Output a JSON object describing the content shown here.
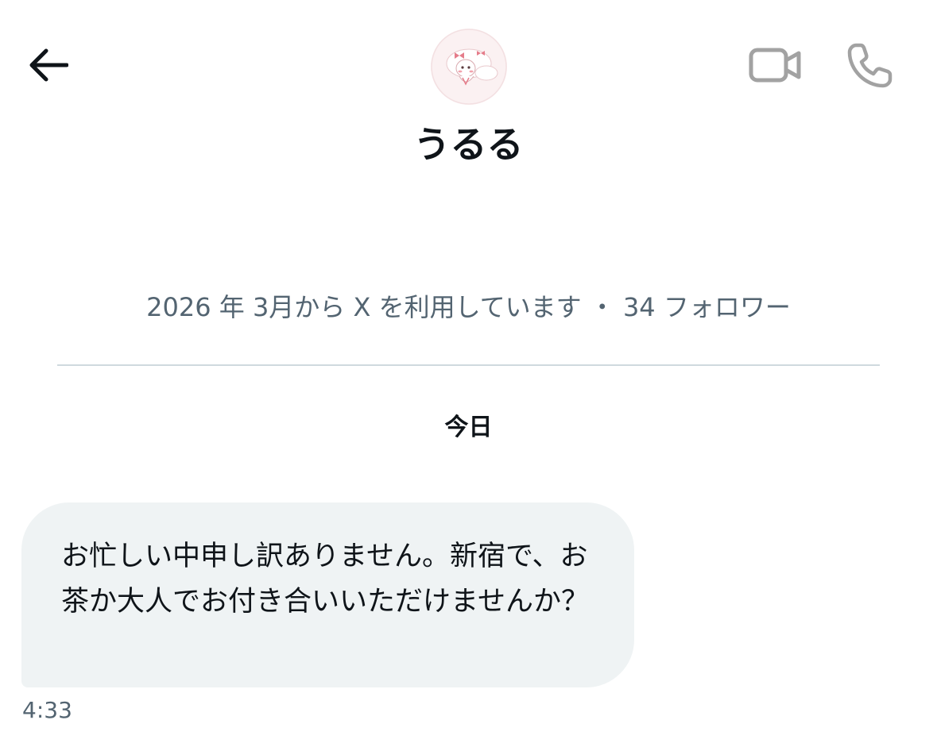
{
  "header": {
    "back_icon": "arrow-left-icon",
    "video_icon": "video-camera-icon",
    "call_icon": "phone-icon",
    "display_name": "うるる",
    "avatar_icon": "illustrated-character-avatar"
  },
  "profile": {
    "account_info": "2026 年 3月から X を利用しています ・ 34 フォロワー"
  },
  "conversation": {
    "date_label": "今日",
    "messages": [
      {
        "text": "お忙しい中申し訳ありません。新宿で、お茶か大人でお付き合いいただけませんか？",
        "time": "4:33"
      }
    ]
  },
  "colors": {
    "text_primary": "#0f1419",
    "text_secondary": "#536471",
    "bubble_background": "#eff3f4",
    "divider": "#cfd9de",
    "icon_gray": "#a2a2a2",
    "avatar_background": "#fbf1f2"
  }
}
